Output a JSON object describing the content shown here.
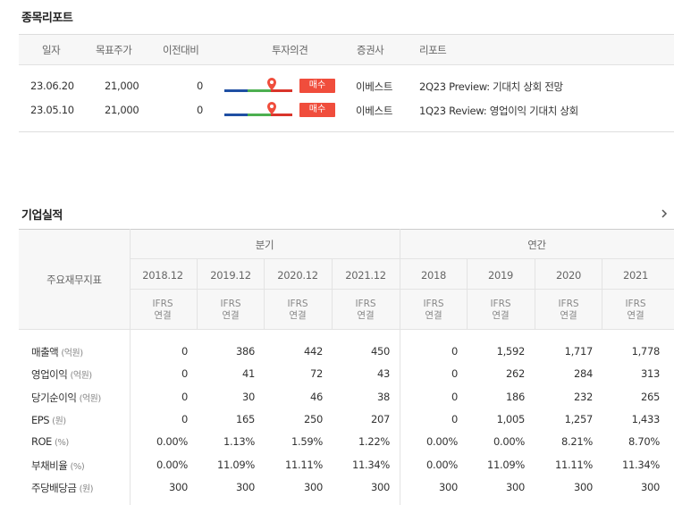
{
  "reports": {
    "title": "종목리포트",
    "headers": [
      "일자",
      "목표주가",
      "이전대비",
      "투자의견",
      "증권사",
      "리포트"
    ],
    "rows": [
      {
        "date": "23.06.20",
        "target": "21,000",
        "change": "0",
        "opinion": "매수",
        "broker": "이베스트",
        "title": "2Q23 Preview: 기대치 상회 전망"
      },
      {
        "date": "23.05.10",
        "target": "21,000",
        "change": "0",
        "opinion": "매수",
        "broker": "이베스트",
        "title": "1Q23 Review: 영업이익 기대치 상회"
      }
    ]
  },
  "financials": {
    "title": "기업실적",
    "more_icon": "chevron-right-icon",
    "row_header": "주요재무지표",
    "group_quarter": "분기",
    "group_annual": "연간",
    "periods": [
      "2018.12",
      "2019.12",
      "2020.12",
      "2021.12",
      "2018",
      "2019",
      "2020",
      "2021"
    ],
    "ifrs_line1": "IFRS",
    "ifrs_line2": "연결",
    "rows": [
      {
        "label": "매출액",
        "unit": "(억원)",
        "values": [
          "0",
          "386",
          "442",
          "450",
          "0",
          "1,592",
          "1,717",
          "1,778"
        ]
      },
      {
        "label": "영업이익",
        "unit": "(억원)",
        "values": [
          "0",
          "41",
          "72",
          "43",
          "0",
          "262",
          "284",
          "313"
        ]
      },
      {
        "label": "당기순이익",
        "unit": "(억원)",
        "values": [
          "0",
          "30",
          "46",
          "38",
          "0",
          "186",
          "232",
          "265"
        ]
      },
      {
        "label": "EPS",
        "unit": "(원)",
        "values": [
          "0",
          "165",
          "250",
          "207",
          "0",
          "1,005",
          "1,257",
          "1,433"
        ]
      },
      {
        "label": "ROE",
        "unit": "(%)",
        "values": [
          "0.00%",
          "1.13%",
          "1.59%",
          "1.22%",
          "0.00%",
          "0.00%",
          "8.21%",
          "8.70%"
        ]
      },
      {
        "label": "부채비율",
        "unit": "(%)",
        "values": [
          "0.00%",
          "11.09%",
          "11.11%",
          "11.34%",
          "0.00%",
          "11.09%",
          "11.11%",
          "11.34%"
        ]
      },
      {
        "label": "주당배당금",
        "unit": "(원)",
        "values": [
          "300",
          "300",
          "300",
          "300",
          "300",
          "300",
          "300",
          "300"
        ]
      }
    ]
  },
  "colors": {
    "badge": "#f04d3c",
    "gauge_blue": "#1f4fa3",
    "gauge_green": "#4caf50",
    "gauge_red": "#d9352b"
  }
}
